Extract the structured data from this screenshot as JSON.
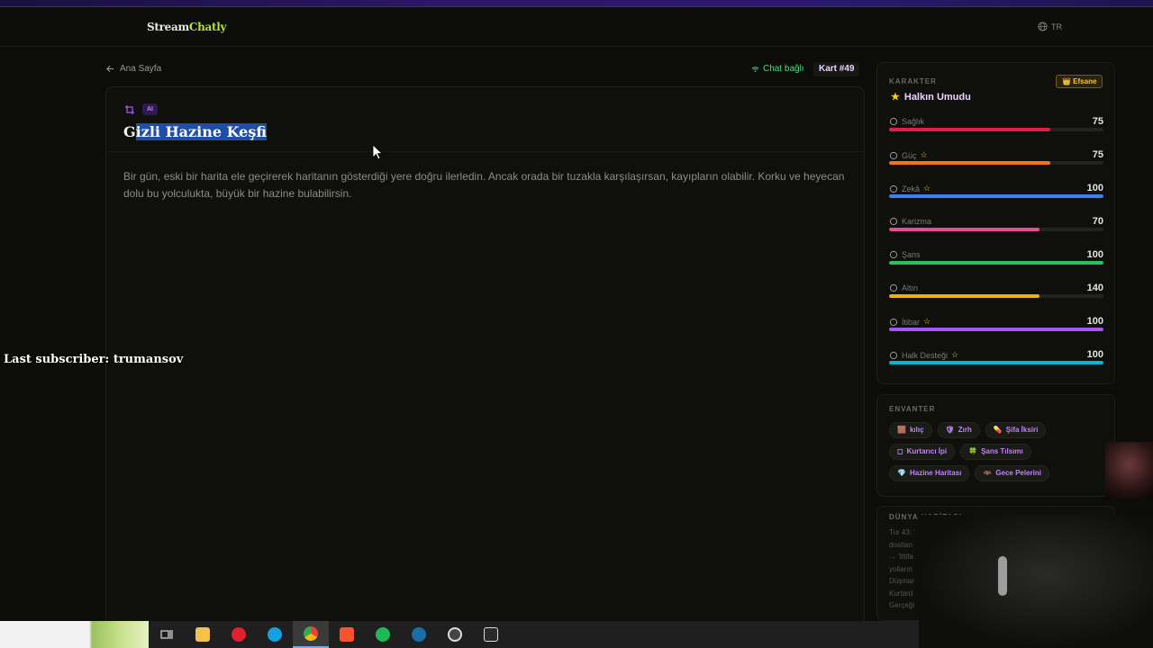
{
  "navbar": {
    "logo_part1": "Stream",
    "logo_part2": "Chatly",
    "lang": "TR"
  },
  "back_label": "Ana Sayfa",
  "chat_status": "Chat bağlı",
  "card_badge": "Kart #49",
  "card": {
    "tag": "AI",
    "title_first": "G",
    "title_selected": "izli Hazine Keşfi",
    "description": "Bir gün, eski bir harita ele geçirerek haritanın gösterdiği yere doğru ilerledin. Ancak orada bir tuzakla karşılaşırsan, kayıpların olabilir. Korku ve heyecan dolu bu yolculukta, büyük bir hazine bulabilirsin."
  },
  "overlay": {
    "last_subscriber": "Last subscriber: trumansov"
  },
  "character": {
    "section": "KARAKTER",
    "rank": "👑 Efsane",
    "name": "Halkın Umudu",
    "stats": [
      {
        "label": "Sağlık",
        "value": "75",
        "fill": 0.75,
        "color": "#e11d48",
        "icon": "heart-icon",
        "starred": false
      },
      {
        "label": "Güç",
        "value": "75",
        "fill": 0.75,
        "color": "#f97316",
        "icon": "sword-icon",
        "starred": true
      },
      {
        "label": "Zekâ",
        "value": "100",
        "fill": 1.0,
        "color": "#3b82f6",
        "icon": "brain-icon",
        "starred": true
      },
      {
        "label": "Karizma",
        "value": "70",
        "fill": 0.7,
        "color": "#ec4899",
        "icon": "chat-icon",
        "starred": false
      },
      {
        "label": "Şans",
        "value": "100",
        "fill": 1.0,
        "color": "#22c55e",
        "icon": "clover-icon",
        "starred": false
      },
      {
        "label": "Altın",
        "value": "140",
        "fill": 0.7,
        "color": "#eab308",
        "icon": "coin-icon",
        "starred": false
      },
      {
        "label": "İtibar",
        "value": "100",
        "fill": 1.0,
        "color": "#a855f7",
        "icon": "crown-icon",
        "starred": true
      },
      {
        "label": "Halk Desteği",
        "value": "100",
        "fill": 1.0,
        "color": "#06b6d4",
        "icon": "people-icon",
        "starred": true
      }
    ]
  },
  "inventory": {
    "section": "ENVANTER",
    "items": [
      {
        "icon": "🟫",
        "label": "kılıç"
      },
      {
        "icon": "🛡",
        "label": "Zırh"
      },
      {
        "icon": "💊",
        "label": "Şifa İksiri"
      },
      {
        "icon": "◻",
        "label": "Kurtarıcı İpi"
      },
      {
        "icon": "🍀",
        "label": "Şans Tılsımı"
      },
      {
        "icon": "💎",
        "label": "Hazine Haritası"
      },
      {
        "icon": "🦇",
        "label": "Gece Pelerini"
      }
    ]
  },
  "world": {
    "section": "DÜNYA HARİTASI",
    "lines": [
      "Tur 43: '",
      "dostları",
      "→ 'İttifa",
      "yolların",
      "Düşmar",
      "Kurtard",
      "Gerçeği"
    ]
  },
  "colors": {
    "accent_green": "#b6e23a",
    "accent_purple": "#c084fc",
    "selection": "#1e4ea8"
  }
}
